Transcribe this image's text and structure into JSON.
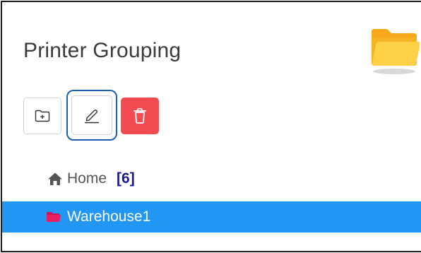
{
  "header": {
    "title": "Printer Grouping"
  },
  "toolbar": {
    "buttons": [
      {
        "name": "add-folder-button",
        "icon": "folder-plus-icon"
      },
      {
        "name": "edit-button",
        "icon": "pencil-icon"
      },
      {
        "name": "delete-button",
        "icon": "trash-icon"
      }
    ]
  },
  "tree": {
    "home": {
      "icon": "home-icon",
      "label": "Home",
      "count": "[6]"
    },
    "items": [
      {
        "icon": "folder-icon",
        "label": "Warehouse1",
        "selected": true
      }
    ]
  },
  "colors": {
    "selection": "#2196f3",
    "delete": "#f44a52",
    "focus_outline": "#1a5fb4",
    "count_text": "#1a1a8c",
    "folder_icon": "#e91e63",
    "folder_art": "#f9b81d"
  }
}
